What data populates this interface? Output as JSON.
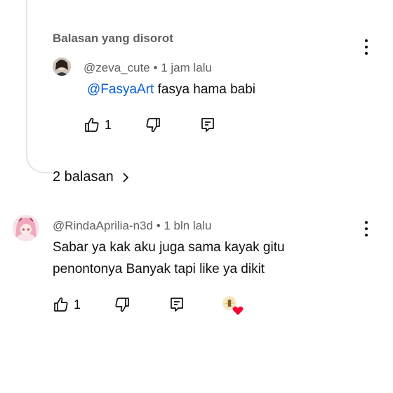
{
  "highlighted_section": {
    "label": "Balasan yang disorot",
    "reply": {
      "author": "@zeva_cute",
      "separator": "•",
      "time": "1 jam lalu",
      "mention": "@FasyaArt",
      "text": "fasya hama babi",
      "like_count": "1"
    }
  },
  "replies_toggle": {
    "label": "2 balasan"
  },
  "comment": {
    "author": "@RindaAprilia-n3d",
    "separator": "•",
    "time": "1 bln lalu",
    "text": "Sabar ya kak aku juga sama kayak gitu penontonya Banyak tapi like ya dikit",
    "like_count": "1"
  },
  "icons": [
    "like-icon",
    "dislike-icon",
    "reply-icon",
    "more-vert-icon",
    "chevron-right-icon",
    "creator-heart-icon"
  ],
  "colors": {
    "link": "#065fd4",
    "meta": "#606060",
    "heart": "#ff0000",
    "thread_line": "#e5e5e5"
  }
}
